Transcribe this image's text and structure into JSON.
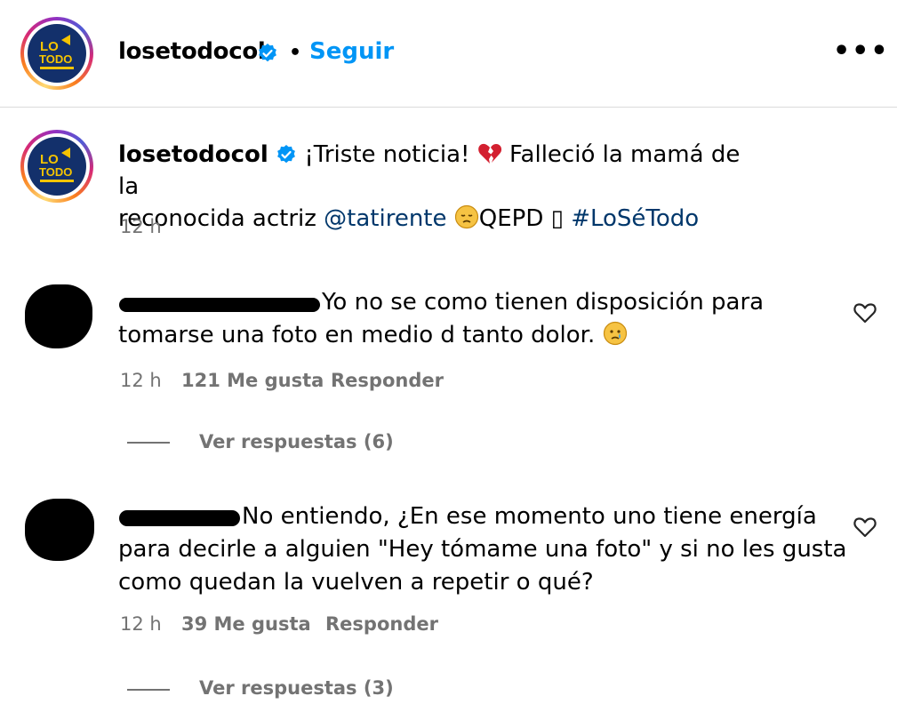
{
  "header": {
    "username": "losetodocol",
    "separator": "•",
    "follow_label": "Seguir",
    "more_label": "•••"
  },
  "caption": {
    "username": "losetodocol",
    "text_1": "¡Triste noticia!",
    "text_2": "Falleció la mamá de la",
    "text_3": "reconocida actriz",
    "mention": "@tatirente",
    "text_4": "QEPD",
    "box_glyph": "▯",
    "hashtag": "#LoSéTodo",
    "time": "12 h"
  },
  "comments": [
    {
      "line_1": "Yo no se como tienen disposición para",
      "line_2": "tomarse una foto en medio d tanto dolor.",
      "time": "12 h",
      "likes": "121 Me gusta",
      "reply_label": "Responder",
      "view_replies": "Ver respuestas (6)"
    },
    {
      "line_1": "No entiendo, ¿En ese momento uno tiene energía",
      "line_2": "para decirle a alguien \"Hey tómame una foto\" y si no les gusta",
      "line_3": "como quedan la vuelven a repetir o qué?",
      "time": "12 h",
      "likes": "39 Me gusta",
      "reply_label": "Responder",
      "view_replies": "Ver respuestas (3)"
    }
  ],
  "colors": {
    "follow": "#0095f6",
    "link": "#00376b",
    "muted": "#737373",
    "verified": "#0095f6",
    "logo_bg": "#13306b",
    "logo_yellow": "#f5c400"
  },
  "icons": {
    "verified": "verified-badge-icon",
    "heart": "heart-outline-icon",
    "broken_heart": "broken-heart-emoji",
    "sad_face": "sad-face-emoji",
    "crying_face": "crying-face-emoji"
  }
}
